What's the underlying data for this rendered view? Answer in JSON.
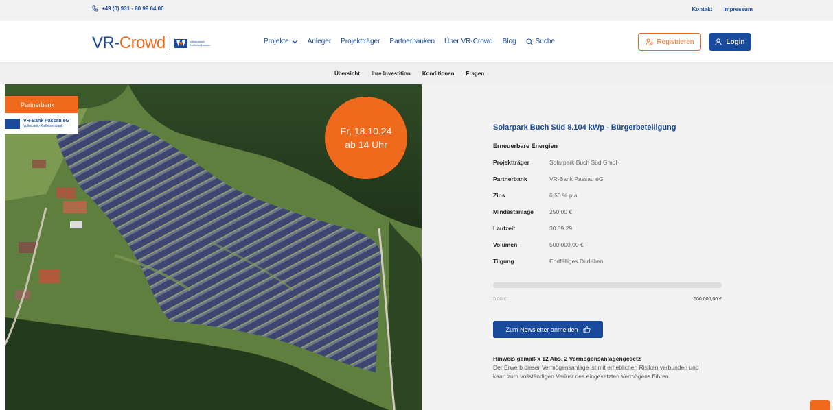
{
  "topbar": {
    "phone_icon": "phone-icon",
    "phone": "+49 (0) 931 - 80 99 64 00",
    "links": [
      "Kontakt",
      "Impressum"
    ]
  },
  "header": {
    "logo": {
      "vr": "VR-",
      "crowd": "Crowd",
      "partner": "Volksbanken Raiffeisenbanken"
    },
    "nav": [
      {
        "label": "Projekte",
        "icon": "chevron-down-icon"
      },
      {
        "label": "Anleger"
      },
      {
        "label": "Projektträger"
      },
      {
        "label": "Partnerbanken"
      },
      {
        "label": "Über VR-Crowd"
      },
      {
        "label": "Blog"
      },
      {
        "label": "Suche",
        "icon": "search-icon"
      }
    ],
    "register_label": "Registrieren",
    "login_label": "Login"
  },
  "subnav": {
    "tabs": [
      "Übersicht",
      "Ihre Investition",
      "Konditionen",
      "Fragen"
    ]
  },
  "hero": {
    "partner_badge": "Partnerbank",
    "bank_name": "VR-Bank Passau eG",
    "bank_sub": "Volksbank-Raiffeisenbank",
    "date_line1": "Fr, 18.10.24",
    "date_line2": "ab 14 Uhr"
  },
  "project": {
    "title": "Solarpark Buch Süd 8.104 kWp - Bürgerbeteiligung",
    "category": "Erneuerbare Energien",
    "details": [
      {
        "key": "Projektträger",
        "value": "Solarpark Buch Süd GmbH"
      },
      {
        "key": "Partnerbank",
        "value": "VR-Bank Passau eG"
      },
      {
        "key": "Zins",
        "value": "6,50 % p.a."
      },
      {
        "key": "Mindestanlage",
        "value": "250,00 €"
      },
      {
        "key": "Laufzeit",
        "value": "30.09.29"
      },
      {
        "key": "Volumen",
        "value": "500.000,00 €"
      },
      {
        "key": "Tilgung",
        "value": "Endfälliges Darlehen"
      }
    ],
    "progress": {
      "current_label": "0,00 €",
      "target_label": "500.000,00 €",
      "fraction": 0
    },
    "newsletter_label": "Zum Newsletter anmelden",
    "hint_title": "Hinweis gemäß § 12 Abs. 2 Vermögensanlagengesetz",
    "hint_text": "Der Erwerb dieser Vermögensanlage ist mit erheblichen Risiken verbunden und kann zum vollständigen Verlust des eingesetzten Vermögens führen."
  },
  "colors": {
    "brand_blue": "#1a4a9c",
    "brand_orange": "#f06a1d"
  }
}
